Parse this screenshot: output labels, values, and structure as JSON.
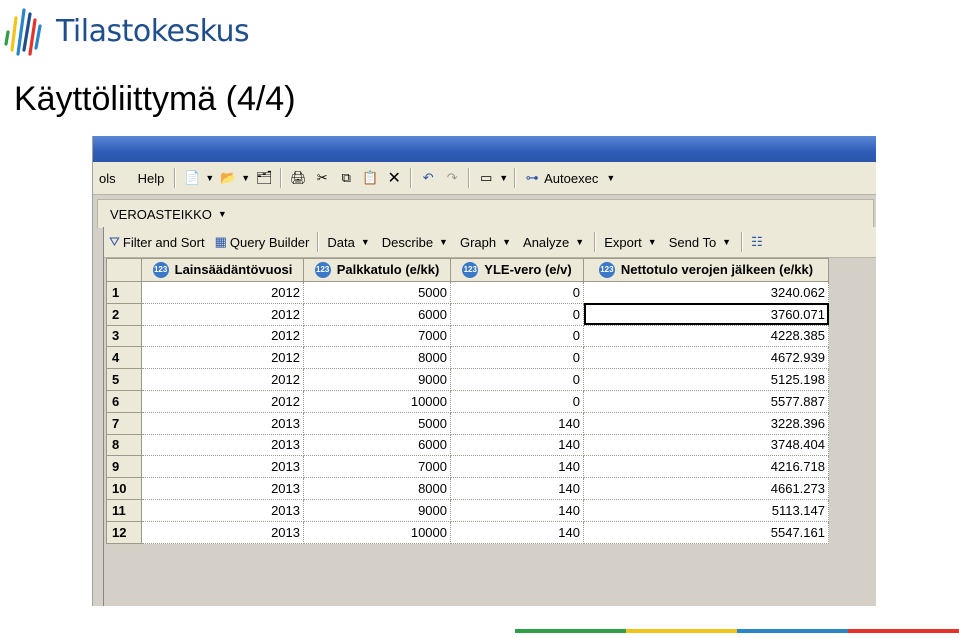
{
  "brand": {
    "name": "Tilastokeskus"
  },
  "slide": {
    "title": "Käyttöliittymä (4/4)"
  },
  "app": {
    "menu": [
      "ols",
      "Help"
    ],
    "autoexec_label": "Autoexec",
    "tab_label": "VEROASTEIKKO",
    "process_toolbar": {
      "filter_sort": "Filter and Sort",
      "query_builder": "Query Builder",
      "data": "Data",
      "describe": "Describe",
      "graph": "Graph",
      "analyze": "Analyze",
      "export": "Export",
      "send_to": "Send To"
    },
    "grid": {
      "columns": [
        "Lainsäädäntövuosi",
        "Palkkatulo (e/kk)",
        "YLE-vero (e/v)",
        "Nettotulo verojen jälkeen (e/kk)"
      ],
      "column_icon": "123",
      "rows": [
        {
          "n": "1",
          "year": "2012",
          "pay": "5000",
          "yle": "0",
          "net": "3240.062"
        },
        {
          "n": "2",
          "year": "2012",
          "pay": "6000",
          "yle": "0",
          "net": "3760.071"
        },
        {
          "n": "3",
          "year": "2012",
          "pay": "7000",
          "yle": "0",
          "net": "4228.385"
        },
        {
          "n": "4",
          "year": "2012",
          "pay": "8000",
          "yle": "0",
          "net": "4672.939"
        },
        {
          "n": "5",
          "year": "2012",
          "pay": "9000",
          "yle": "0",
          "net": "5125.198"
        },
        {
          "n": "6",
          "year": "2012",
          "pay": "10000",
          "yle": "0",
          "net": "5577.887"
        },
        {
          "n": "7",
          "year": "2013",
          "pay": "5000",
          "yle": "140",
          "net": "3228.396"
        },
        {
          "n": "8",
          "year": "2013",
          "pay": "6000",
          "yle": "140",
          "net": "3748.404"
        },
        {
          "n": "9",
          "year": "2013",
          "pay": "7000",
          "yle": "140",
          "net": "4216.718"
        },
        {
          "n": "10",
          "year": "2013",
          "pay": "8000",
          "yle": "140",
          "net": "4661.273"
        },
        {
          "n": "11",
          "year": "2013",
          "pay": "9000",
          "yle": "140",
          "net": "5113.147"
        },
        {
          "n": "12",
          "year": "2013",
          "pay": "10000",
          "yle": "140",
          "net": "5547.161"
        }
      ],
      "selected_row": "2"
    }
  },
  "colors": {
    "brand_blue": "#1f4e8c",
    "bar": [
      "#2e9e4a",
      "#f0c419",
      "#2a86c8",
      "#e6332a"
    ]
  }
}
